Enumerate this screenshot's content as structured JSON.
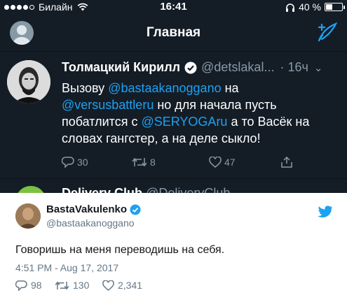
{
  "status_bar": {
    "carrier": "Билайн",
    "time": "16:41",
    "battery_percent": "40 %",
    "battery_level": 0.4,
    "signal_bars_filled": 4,
    "signal_bars_total": 5
  },
  "nav": {
    "title": "Главная"
  },
  "tweet": {
    "author_name": "Толмацкий Кирилл",
    "handle": "@detslakal...",
    "time": "· 16ч",
    "text_segments": {
      "t1": "Вызову ",
      "m1": "@bastaakanoggano",
      "t2": " на",
      "m2": "@versusbattleru",
      "t3": " но для начала пусть побатлится с ",
      "m3": "@SERYOGAru",
      "t4": " а то Васёк на словах гангстер, а на деле сыкло!"
    },
    "replies": "30",
    "retweets": "8",
    "likes": "47"
  },
  "next_tweet": {
    "author_name": "Delivery Club",
    "handle": "@DeliveryClub"
  },
  "embed": {
    "author_name": "BastaVakulenko",
    "handle": "@bastaakanoggano",
    "text": "Говоришь на меня переводишь на себя.",
    "date": "4:51 PM - Aug 17, 2017",
    "replies": "98",
    "retweets": "130",
    "likes": "2,341"
  },
  "colors": {
    "app_background": "#141d26",
    "accent": "#1da1f2",
    "secondary_text": "#8899a6",
    "embed_secondary_text": "#657786"
  },
  "icons": [
    "signal-dots",
    "wifi-icon",
    "headphones-icon",
    "battery-icon",
    "profile-avatar",
    "compose-tweet-icon",
    "verified-icon",
    "chevron-down-icon",
    "reply-icon",
    "retweet-icon",
    "like-icon",
    "share-icon",
    "twitter-bird-icon"
  ]
}
